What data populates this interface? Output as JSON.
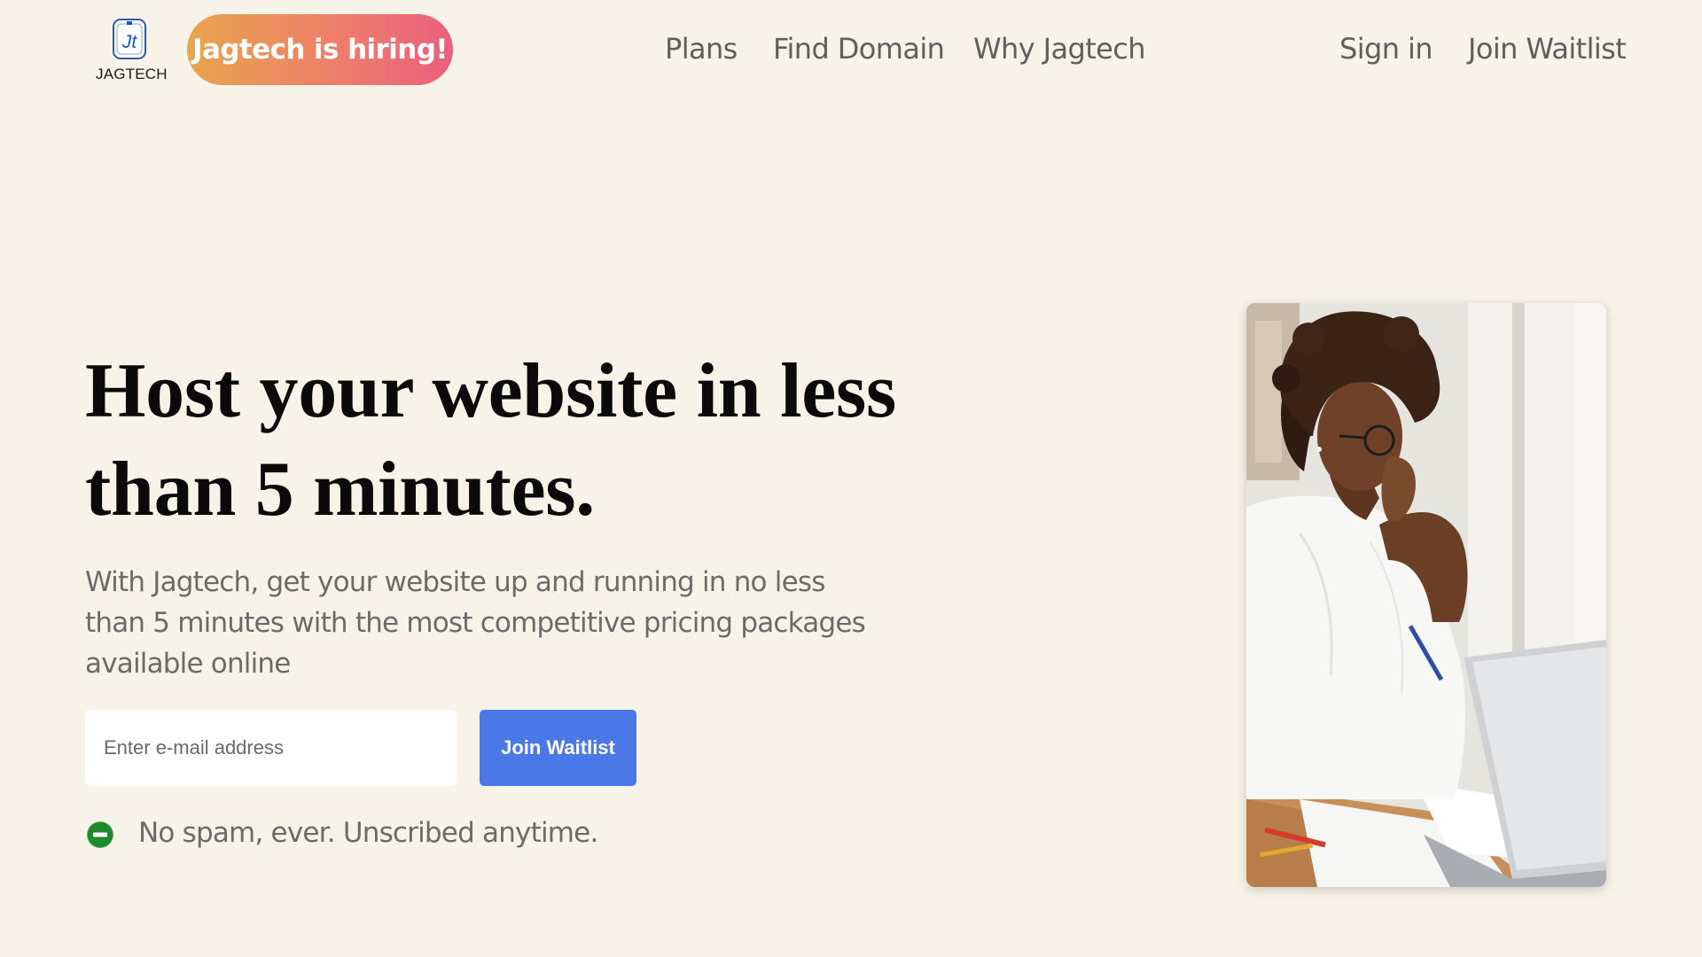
{
  "brand": {
    "name": "JAGTECH",
    "logo_icon": "jt-monogram-icon"
  },
  "header": {
    "hiring_badge": "Jagtech is hiring!",
    "nav": {
      "plans": "Plans",
      "find_domain": "Find Domain",
      "why": "Why Jagtech"
    },
    "sign_in": "Sign in",
    "join_waitlist": "Join Waitlist"
  },
  "hero": {
    "title": "Host your website in less than 5 minutes.",
    "subtitle": "With Jagtech, get your website up and running in no less than 5 minutes with the most competitive pricing packages available online",
    "email_placeholder": "Enter e-mail address",
    "cta_label": "Join Waitlist",
    "no_spam_icon": "minus-circle-icon",
    "no_spam_text": "No spam, ever. Unscribed anytime.",
    "image": "woman-working-on-laptop-photo"
  },
  "colors": {
    "background": "#f7f3e8",
    "badge_gradient_start": "#e8a54d",
    "badge_gradient_end": "#ea5f7e",
    "primary_button": "#4a78e6",
    "nav_text": "#5f5f5f",
    "status_green": "#1e8a2a"
  }
}
